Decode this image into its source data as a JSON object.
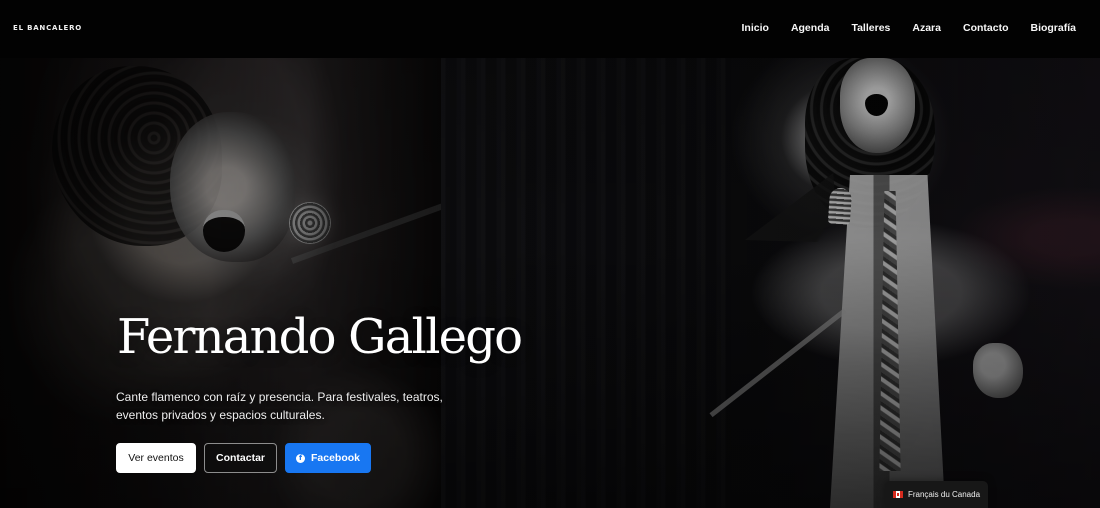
{
  "header": {
    "brand": "EL BANCALERO",
    "nav": [
      {
        "label": "Inicio"
      },
      {
        "label": "Agenda"
      },
      {
        "label": "Talleres"
      },
      {
        "label": "Azara"
      },
      {
        "label": "Contacto"
      },
      {
        "label": "Biografía"
      }
    ]
  },
  "hero": {
    "title": "Fernando Gallego",
    "subtitle": "Cante flamenco con raíz y presencia. Para festivales, teatros, eventos privados y espacios culturales.",
    "buttons": {
      "events": "Ver eventos",
      "contact": "Contactar",
      "facebook": "Facebook",
      "facebook_icon": "facebook-icon"
    }
  },
  "language": {
    "label": "Français du Canada",
    "icon": "canada-flag-icon"
  },
  "colors": {
    "background": "#050505",
    "facebook_blue": "#1877f2"
  }
}
